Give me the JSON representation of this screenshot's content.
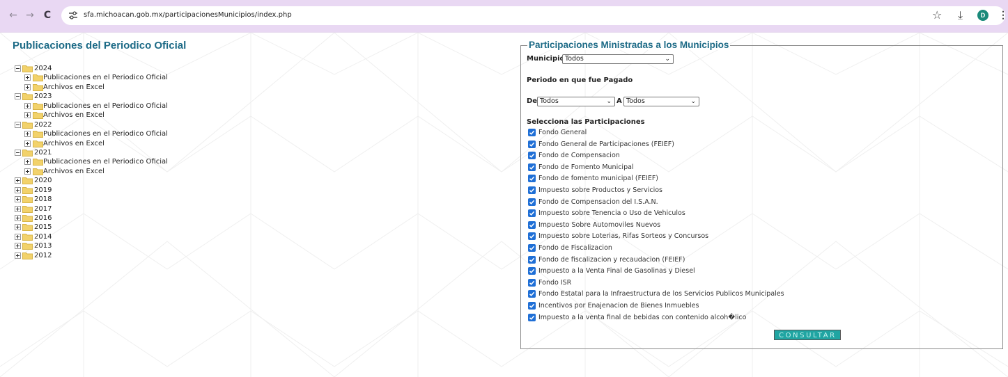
{
  "browser": {
    "url": "sfa.michoacan.gob.mx/participacionesMunicipios/index.php",
    "avatar_letter": "D",
    "back_icon": "←",
    "forward_icon": "→",
    "reload_icon": "C",
    "star_icon": "☆",
    "download_icon": "⤓",
    "menu_icon": "⋮"
  },
  "left": {
    "title": "Publicaciones del Periodico Oficial",
    "tree": [
      {
        "level": 0,
        "label": "2024",
        "expanded": true
      },
      {
        "level": 1,
        "label": "Publicaciones en el Periodico Oficial"
      },
      {
        "level": 1,
        "label": "Archivos en Excel"
      },
      {
        "level": 0,
        "label": "2023",
        "expanded": true
      },
      {
        "level": 1,
        "label": "Publicaciones en el Periodico Oficial"
      },
      {
        "level": 1,
        "label": "Archivos en Excel"
      },
      {
        "level": 0,
        "label": "2022",
        "expanded": true
      },
      {
        "level": 1,
        "label": "Publicaciones en el Periodico Oficial"
      },
      {
        "level": 1,
        "label": "Archivos en Excel"
      },
      {
        "level": 0,
        "label": "2021",
        "expanded": true
      },
      {
        "level": 1,
        "label": "Publicaciones en el Periodico Oficial"
      },
      {
        "level": 1,
        "label": "Archivos en Excel"
      },
      {
        "level": 0,
        "label": "2020",
        "expanded": false
      },
      {
        "level": 0,
        "label": "2019",
        "expanded": false
      },
      {
        "level": 0,
        "label": "2018",
        "expanded": false
      },
      {
        "level": 0,
        "label": "2017",
        "expanded": false
      },
      {
        "level": 0,
        "label": "2016",
        "expanded": false
      },
      {
        "level": 0,
        "label": "2015",
        "expanded": false
      },
      {
        "level": 0,
        "label": "2014",
        "expanded": false
      },
      {
        "level": 0,
        "label": "2013",
        "expanded": false
      },
      {
        "level": 0,
        "label": "2012",
        "expanded": false
      }
    ]
  },
  "form": {
    "legend": "Participaciones Ministradas a los Municipios",
    "municipio_label": "Municipio",
    "municipio_value": "Todos",
    "periodo_label": "Periodo en que fue Pagado",
    "de_label": "De",
    "de_value": "Todos",
    "a_label": "A",
    "a_value": "Todos",
    "selecciona_label": "Selecciona las Participaciones",
    "participaciones": [
      {
        "label": "Fondo General",
        "checked": true
      },
      {
        "label": "Fondo General de Participaciones (FEIEF)",
        "checked": true
      },
      {
        "label": "Fondo de Compensacion",
        "checked": true
      },
      {
        "label": "Fondo de Fomento Municipal",
        "checked": true
      },
      {
        "label": "Fondo de fomento municipal (FEIEF)",
        "checked": true
      },
      {
        "label": "Impuesto sobre Productos y Servicios",
        "checked": true
      },
      {
        "label": "Fondo de Compensacion del I.S.A.N.",
        "checked": true
      },
      {
        "label": "Impuesto sobre Tenencia o Uso de Vehiculos",
        "checked": true
      },
      {
        "label": "Impuesto Sobre Automoviles Nuevos",
        "checked": true
      },
      {
        "label": "Impuesto sobre Loterias, Rifas Sorteos y Concursos",
        "checked": true
      },
      {
        "label": "Fondo de Fiscalizacion",
        "checked": true
      },
      {
        "label": "Fondo de fiscalizacion y recaudacion (FEIEF)",
        "checked": true
      },
      {
        "label": "Impuesto a la Venta Final de Gasolinas y Diesel",
        "checked": true
      },
      {
        "label": "Fondo ISR",
        "checked": true
      },
      {
        "label": "Fondo Estatal para la Infraestructura de los Servicios Publicos Municipales",
        "checked": true
      },
      {
        "label": "Incentivos por Enajenacion de Bienes Inmuebles",
        "checked": true
      },
      {
        "label": "Impuesto a la venta final de bebidas con contenido alcoh�lico",
        "checked": true
      }
    ],
    "submit_label": "CONSULTAR"
  },
  "colors": {
    "title": "#1c6a86",
    "browser_bar": "#e9d8f3",
    "checkbox": "#1f6fd6",
    "button": "#20a5a2",
    "folder": "#f2d26b"
  }
}
